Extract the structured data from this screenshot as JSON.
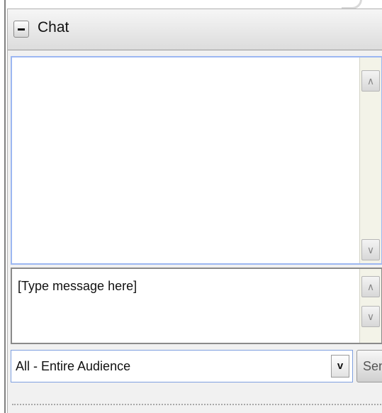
{
  "header": {
    "title": "Chat",
    "collapse_icon": "minus-icon"
  },
  "chat_log": {
    "messages": [],
    "scroll_up_icon": "chevron-up-icon",
    "scroll_down_icon": "chevron-down-icon"
  },
  "message_input": {
    "value": "[Type message here]",
    "scroll_up_icon": "chevron-up-icon",
    "scroll_down_icon": "chevron-down-icon"
  },
  "audience": {
    "selected": "All - Entire Audience",
    "dropdown_icon": "chevron-down-icon"
  },
  "send_label": "Send",
  "colors": {
    "focus_border": "#9cb7f2",
    "panel_background": "#f1f1f1",
    "scrollbar_track": "#f3f3e8"
  }
}
